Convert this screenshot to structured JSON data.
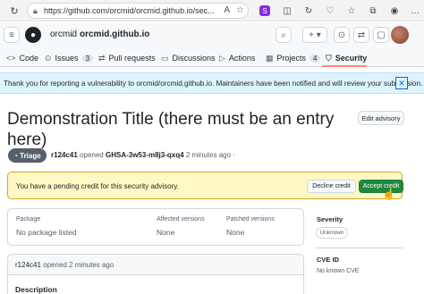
{
  "browser": {
    "url": "https://github.com/orcmid/orcmid.github.io/sec...",
    "url_scheme": "https://",
    "read_aloud_icon": "A",
    "ext_icons": [
      "☆",
      "◫",
      "🛡",
      "↻",
      "⧉",
      "♡",
      "…"
    ]
  },
  "header": {
    "owner": "orcmid",
    "separator": "/",
    "repo": "orcmid.github.io",
    "search_icon": "⌕",
    "plus_label": "+ ▾",
    "issues_icon": "⊙",
    "pr_icon": "⇄",
    "inbox_icon": "▢"
  },
  "tabs": [
    {
      "label": "Code",
      "icon": "<>"
    },
    {
      "label": "Issues",
      "icon": "⊙",
      "count": "3"
    },
    {
      "label": "Pull requests",
      "icon": "⇄"
    },
    {
      "label": "Discussions",
      "icon": "▭"
    },
    {
      "label": "Actions",
      "icon": "▷"
    },
    {
      "label": "Projects",
      "icon": "▦",
      "count": "4"
    },
    {
      "label": "Security",
      "icon": "⛉"
    }
  ],
  "flash": {
    "message": "Thank you for reporting a vulnerability to orcmid/orcmid.github.io. Maintainers have been notified and will review your submission.",
    "close_icon": "✕"
  },
  "advisory": {
    "title": "Demonstration Title (there must be an entry here)",
    "edit_label": "Edit advisory",
    "status": "Triage",
    "status_icon": "◔",
    "author": "r124c41",
    "opened_text": "opened",
    "ghsa_id": "GHSA-3w53-m8j3-qxq4",
    "time": "2 minutes ago",
    "dash": "·"
  },
  "credit": {
    "message": "You have a pending credit for this security advisory.",
    "decline_label": "Decline credit",
    "accept_label": "Accept credit"
  },
  "package": {
    "headers": [
      "Package",
      "Affected versions",
      "Patched versions"
    ],
    "values": [
      "No package listed",
      "None",
      "None"
    ]
  },
  "sidebar": {
    "severity_label": "Severity",
    "severity_value": "Unknown",
    "cve_label": "CVE ID",
    "cve_value": "No known CVE"
  },
  "comment": {
    "author": "r124c41",
    "meta": "opened 2 minutes ago",
    "description_label": "Description"
  }
}
